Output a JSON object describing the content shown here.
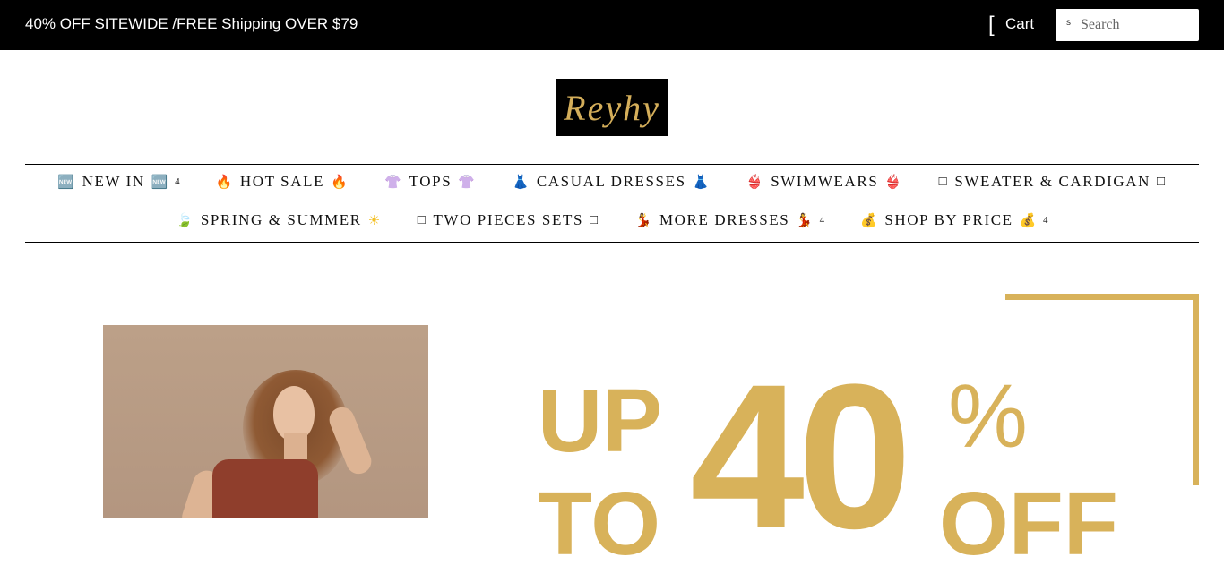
{
  "announcement": "40% OFF SITEWIDE /FREE Shipping OVER $79",
  "cart": {
    "glyph": "[",
    "label": "Cart"
  },
  "search": {
    "icon_glyph": "s",
    "placeholder": "Search",
    "icon": "search-icon"
  },
  "logo": {
    "text": "Reyhy"
  },
  "nav": {
    "row1": [
      {
        "pre": "🆕",
        "label": "NEW IN",
        "post": "🆕",
        "count": "4"
      },
      {
        "pre": "🔥",
        "label": "HOT SALE",
        "post": "🔥",
        "count": ""
      },
      {
        "pre": "👚",
        "label": "TOPS",
        "post": "👚",
        "count": ""
      },
      {
        "pre": "👗",
        "label": "CASUAL DRESSES",
        "post": "👗",
        "count": ""
      },
      {
        "pre": "👙",
        "label": "SWIMWEARS",
        "post": "👙",
        "count": ""
      },
      {
        "pre": "",
        "label": "SWEATER & CARDIGAN",
        "post": "",
        "count": ""
      }
    ],
    "row2": [
      {
        "pre": "🍃",
        "label": "SPRING & SUMMER",
        "post": "☀",
        "count": ""
      },
      {
        "pre": "",
        "label": "TWO PIECES SETS",
        "post": "",
        "count": ""
      },
      {
        "pre": "💃",
        "label": "MORE DRESSES",
        "post": "💃",
        "count": "4"
      },
      {
        "pre": "💰",
        "label": "SHOP BY PRICE",
        "post": "💰",
        "count": "4"
      }
    ]
  },
  "hero": {
    "promo_up": "UP",
    "promo_to": "TO",
    "promo_number": "40",
    "promo_percent": "%",
    "promo_off": "OFF"
  },
  "colors": {
    "topbar": "#000000",
    "gold": "#d8b25a",
    "logo_bg": "#000000"
  }
}
